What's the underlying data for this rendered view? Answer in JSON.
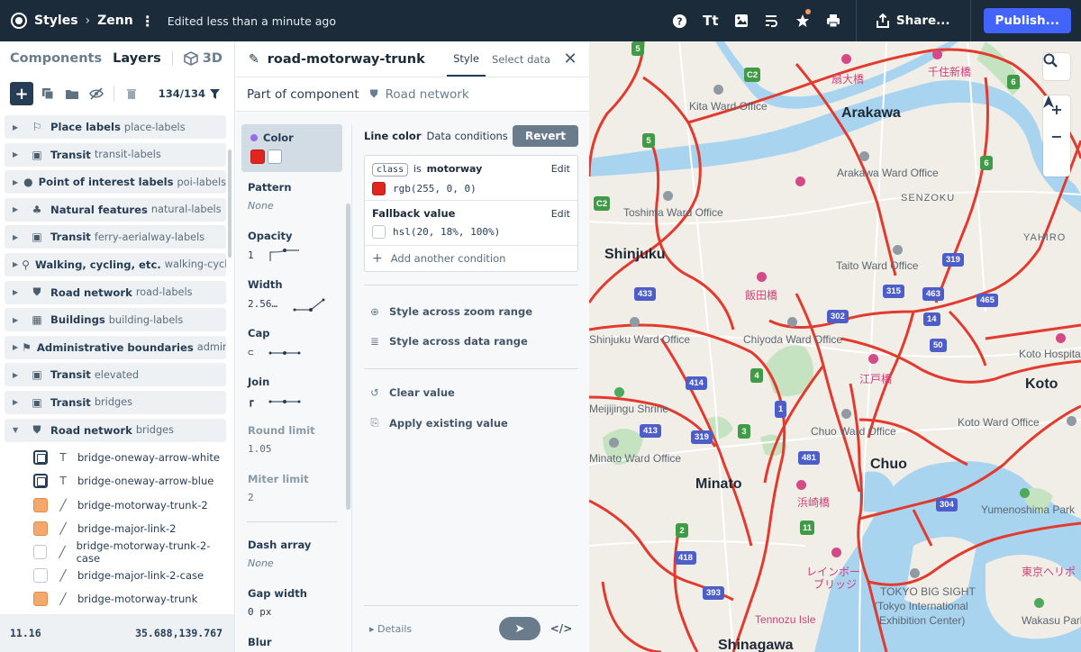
{
  "topbar": {
    "app": "Styles",
    "project": "Zenn",
    "edited": "Edited less than a minute ago",
    "share_label": "Share...",
    "publish_label": "Publish..."
  },
  "left": {
    "tab_components": "Components",
    "tab_layers": "Layers",
    "tab_3d": "3D",
    "count": "134/134",
    "groups": [
      {
        "name": "Place labels",
        "id": "place-labels",
        "icon": "place-label-icon"
      },
      {
        "name": "Transit",
        "id": "transit-labels",
        "icon": "transit-icon"
      },
      {
        "name": "Point of interest labels",
        "id": "poi-labels",
        "icon": "pin-icon"
      },
      {
        "name": "Natural features",
        "id": "natural-labels",
        "icon": "trees-icon"
      },
      {
        "name": "Transit",
        "id": "ferry-aerialway-labels",
        "icon": "transit-icon"
      },
      {
        "name": "Walking, cycling, etc.",
        "id": "walking-cycling",
        "icon": "walking-icon"
      },
      {
        "name": "Road network",
        "id": "road-labels",
        "icon": "road-icon"
      },
      {
        "name": "Buildings",
        "id": "building-labels",
        "icon": "building-icon"
      },
      {
        "name": "Administrative boundaries",
        "id": "admin",
        "icon": "flag-icon"
      },
      {
        "name": "Transit",
        "id": "elevated",
        "icon": "transit-icon"
      },
      {
        "name": "Transit",
        "id": "bridges",
        "icon": "transit-icon"
      },
      {
        "name": "Road network",
        "id": "bridges",
        "icon": "road-icon"
      }
    ],
    "layers": [
      {
        "name": "bridge-oneway-arrow-white",
        "swatch": "img",
        "type": "symbol"
      },
      {
        "name": "bridge-oneway-arrow-blue",
        "swatch": "img",
        "type": "symbol"
      },
      {
        "name": "bridge-motorway-trunk-2",
        "swatch": "orange",
        "type": "line"
      },
      {
        "name": "bridge-major-link-2",
        "swatch": "orange",
        "type": "line"
      },
      {
        "name": "bridge-motorway-trunk-2-case",
        "swatch": "white",
        "type": "line"
      },
      {
        "name": "bridge-major-link-2-case",
        "swatch": "white",
        "type": "line"
      },
      {
        "name": "bridge-motorway-trunk",
        "swatch": "orange",
        "type": "line"
      }
    ],
    "zoom": "11.16",
    "coords": "35.688,139.767"
  },
  "editor": {
    "title": "road-motorway-trunk",
    "tab_style": "Style",
    "tab_select": "Select data",
    "part_of": "Part of component",
    "component": "Road network",
    "props": {
      "color": "Color",
      "pattern": "Pattern",
      "pattern_val": "None",
      "opacity": "Opacity",
      "opacity_val": "1",
      "width": "Width",
      "width_val": "2.56…",
      "cap": "Cap",
      "join": "Join",
      "round_limit": "Round limit",
      "round_limit_val": "1.05",
      "miter_limit": "Miter limit",
      "miter_limit_val": "2",
      "dash_array": "Dash array",
      "dash_array_val": "None",
      "gap_width": "Gap width",
      "gap_width_val": "0 px",
      "blur": "Blur"
    },
    "line_color": "Line color",
    "data_conditions": "Data conditions",
    "revert": "Revert",
    "cond": {
      "field": "class",
      "is": "is",
      "value": "motorway",
      "edit": "Edit",
      "color": "rgb(255, 0, 0)"
    },
    "fallback": {
      "title": "Fallback value",
      "edit": "Edit",
      "color": "hsl(20, 18%, 100%)"
    },
    "add_condition": "Add another condition",
    "zoom_range": "Style across zoom range",
    "data_range": "Style across data range",
    "clear_value": "Clear value",
    "apply_existing": "Apply existing value",
    "details": "Details"
  },
  "colors": {
    "topbar": "#1b2b3a",
    "accent": "#4264fb",
    "road": "#e23a2e"
  },
  "map": {
    "labels_big": [
      "Arakawa",
      "Shinjuku",
      "Chuo",
      "Minato",
      "Koto",
      "Shinagawa"
    ],
    "labels_sm": [
      "Kita Ward Office",
      "Arakawa Ward Office",
      "Toshima Ward Office",
      "SENZOKU",
      "YAHIRO",
      "Taito Ward Office",
      "Chiyoda Ward Office",
      "Shinjuku Ward Office",
      "Chuo Ward Office",
      "Koto Ward Office",
      "Koto Hospital",
      "Meijijingu Shrine",
      "Minato Ward Office",
      "Yumenoshima Park",
      "TOKYO BIG SIGHT",
      "(Tokyo International",
      "Exhibition Center)",
      "Wakasu Park",
      "Tennozu Isle"
    ],
    "labels_jp": [
      "扇大橋",
      "千住新橋",
      "飯田橋",
      "江戸橋",
      "浜崎橋",
      "レインボー",
      "ブリッジ",
      "東京ヘリポ"
    ],
    "shields": [
      "5",
      "C2",
      "6",
      "5",
      "6",
      "C2",
      "319",
      "433",
      "315",
      "463",
      "465",
      "302",
      "14",
      "50",
      "414",
      "4",
      "1",
      "413",
      "319",
      "3",
      "481",
      "304",
      "11",
      "2",
      "418",
      "393"
    ]
  }
}
